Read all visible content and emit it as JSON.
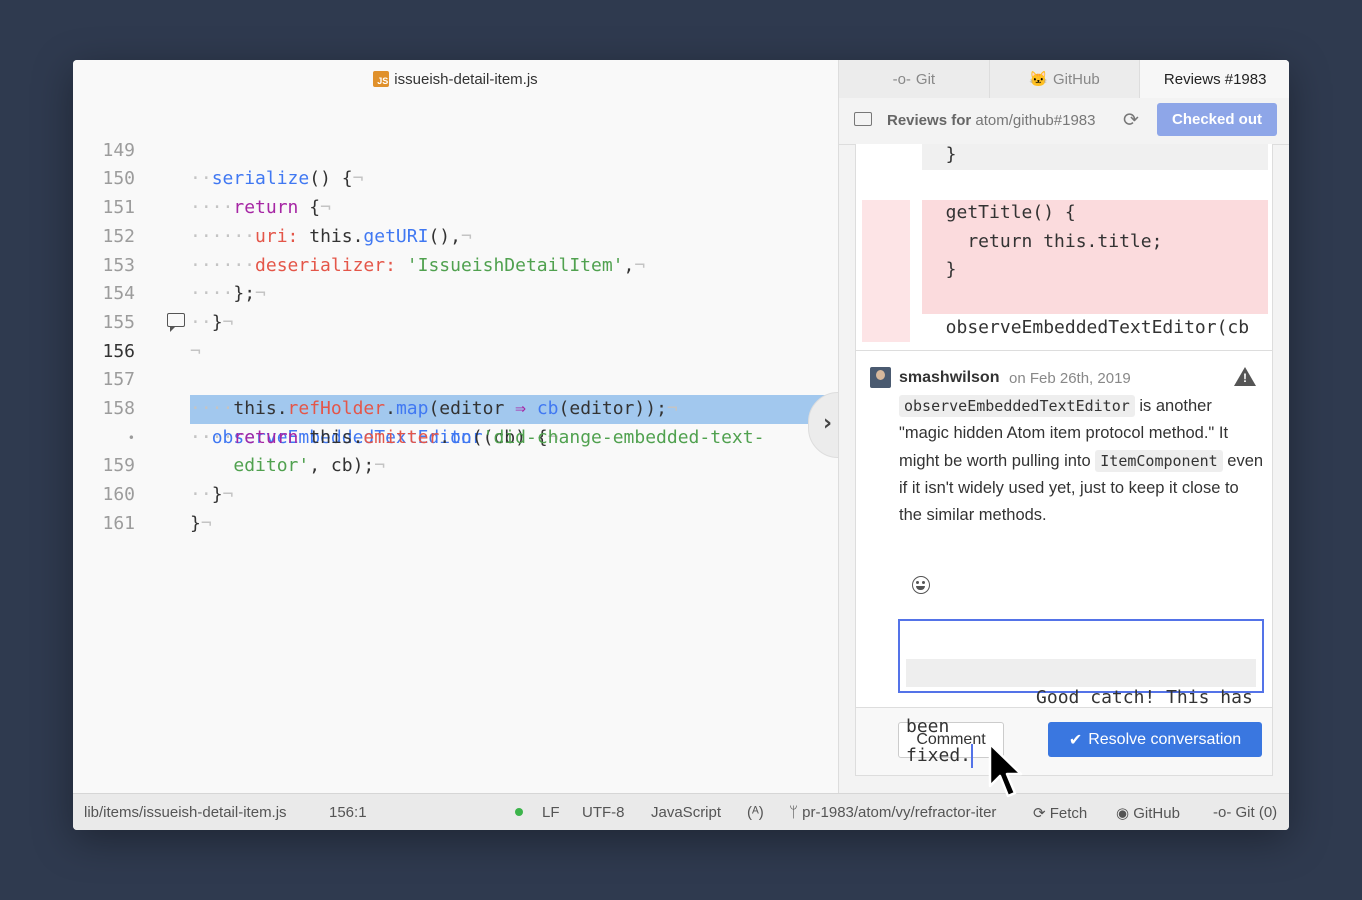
{
  "editor": {
    "tab_title": "issueish-detail-item.js",
    "tab_badge": "JS",
    "lines": [
      {
        "n": "149"
      },
      {
        "n": "150"
      },
      {
        "n": "151"
      },
      {
        "n": "152"
      },
      {
        "n": "153"
      },
      {
        "n": "154"
      },
      {
        "n": "155"
      },
      {
        "n": "156"
      },
      {
        "n": "157"
      },
      {
        "n": "158"
      },
      {
        "n": "•"
      },
      {
        "n": "159"
      },
      {
        "n": "160"
      },
      {
        "n": "161"
      }
    ],
    "code": {
      "l149": "serialize",
      "l150": "return",
      "l151_key": "uri:",
      "l151_fn": "getURI",
      "l152_key": "deserializer:",
      "l152_str": "'IssueishDetailItem'",
      "l156_fn": "observeEmbeddedTextEditor",
      "l157_prop": "refHolder",
      "l157_fn": "map",
      "l157_cb": "cb",
      "l158_ret": "return",
      "l158_prop": "emitter",
      "l158_fn": "on",
      "l158_str1": "'did-change-embedded-text-",
      "l158_str2": "editor'"
    }
  },
  "panel": {
    "tabs": [
      {
        "label": "Git"
      },
      {
        "label": "GitHub"
      },
      {
        "label": "Reviews #1983"
      }
    ],
    "header": {
      "prefix": "Reviews for",
      "repo": "atom/github#1983",
      "checked_out_label": "Checked out"
    },
    "diff": {
      "l1": "  }",
      "l2": "  getTitle() {",
      "l3": "    return this.title;",
      "l4": "  }",
      "l5": "  observeEmbeddedTextEditor(cb"
    },
    "comment": {
      "author": "smashwilson",
      "date": "on Feb 26th, 2019",
      "code1": "observeEmbeddedTextEditor",
      "text1": " is another \"magic hidden Atom item protocol method.\" It might be worth pulling into ",
      "code2": "ItemComponent",
      "text2": " even if it isn't widely used yet, just to keep it close to the similar methods."
    },
    "reply": {
      "line1": "Good catch! This has been",
      "line2": "fixed."
    },
    "buttons": {
      "comment": "Comment",
      "resolve": "Resolve conversation"
    }
  },
  "status_bar": {
    "file_path": "lib/items/issueish-detail-item.js",
    "cursor_pos": "156:1",
    "line_ending": "LF",
    "encoding": "UTF-8",
    "grammar": "JavaScript",
    "branch": "pr-1983/atom/vy/refractor-iter",
    "fetch": "Fetch",
    "github": "GitHub",
    "git": "Git (0)"
  },
  "colors": {
    "accent": "#5473e8",
    "resolve": "#3a77e0",
    "checked_out": "#8ea6e8",
    "highlight": "#a2c8ee",
    "deleted": "#fbdbdd"
  }
}
